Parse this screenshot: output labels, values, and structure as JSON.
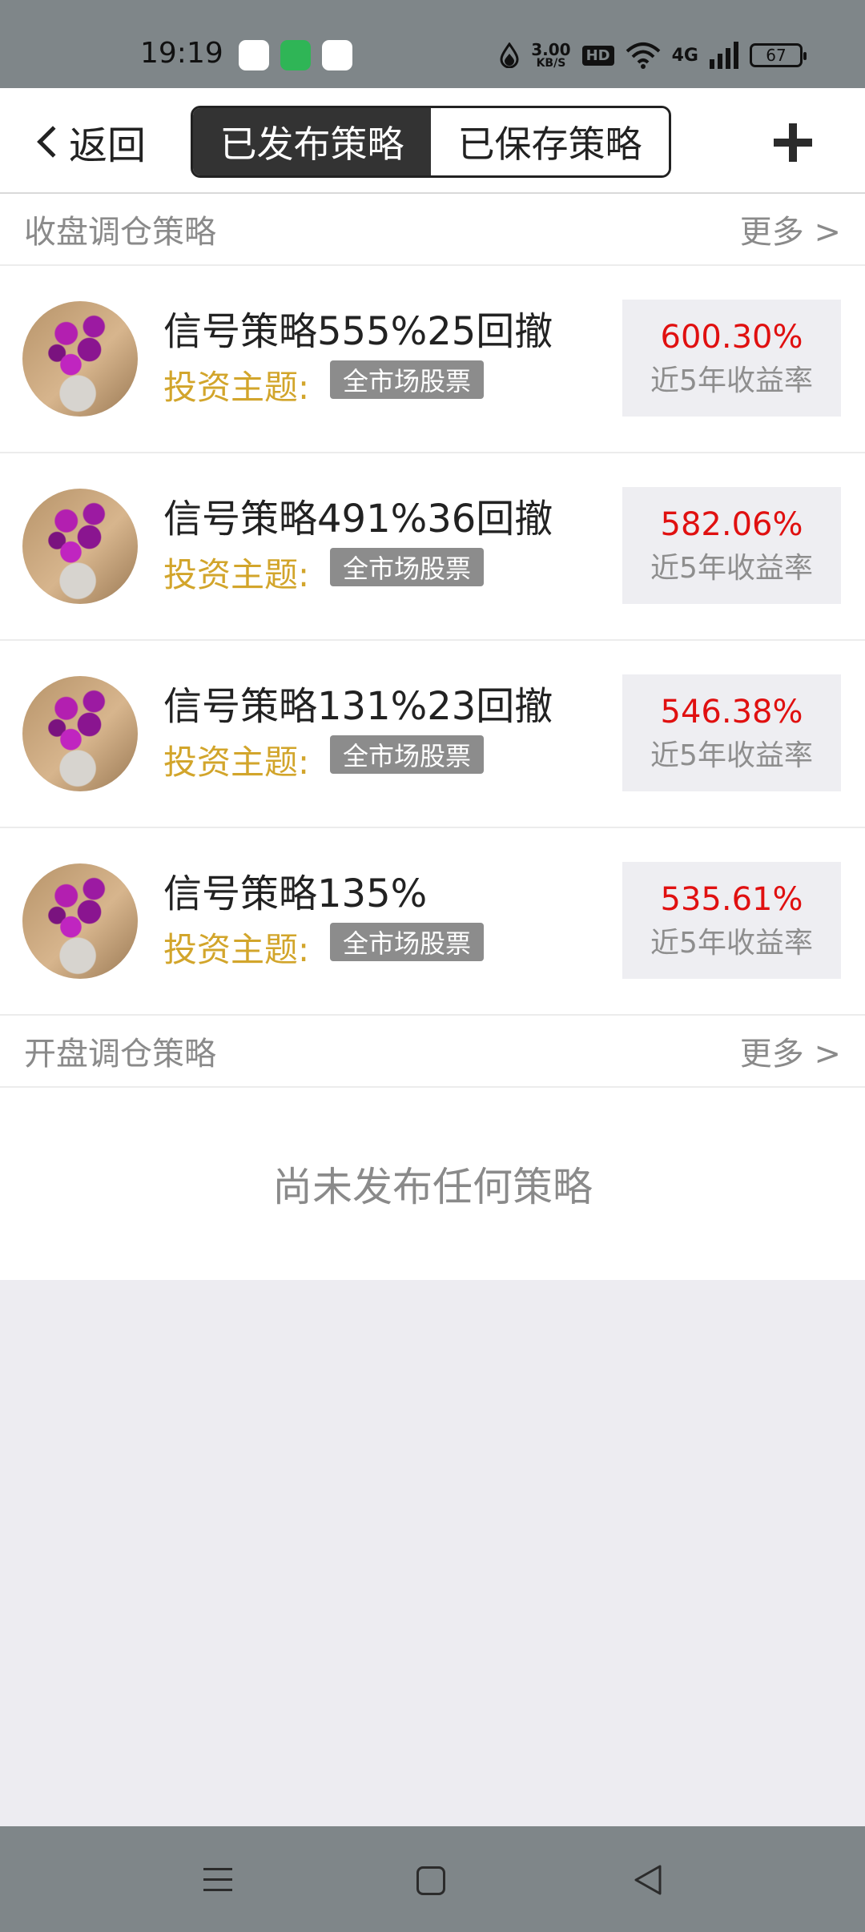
{
  "status_bar": {
    "time": "19:19",
    "net_speed_value": "3.00",
    "net_speed_unit": "KB/S",
    "hd_label": "HD",
    "network": "4G",
    "battery": "67"
  },
  "header": {
    "back_label": "返回",
    "tabs": [
      {
        "label": "已发布策略",
        "active": true
      },
      {
        "label": "已保存策略",
        "active": false
      }
    ],
    "add_icon": "plus-icon"
  },
  "sections": [
    {
      "title": "收盘调仓策略",
      "more_label": "更多 >",
      "items": [
        {
          "title": "信号策略555%25回撤",
          "topic_label": "投资主题:",
          "topic_tag": "全市场股票",
          "return_value": "600.30%",
          "return_label": "近5年收益率"
        },
        {
          "title": "信号策略491%36回撤",
          "topic_label": "投资主题:",
          "topic_tag": "全市场股票",
          "return_value": "582.06%",
          "return_label": "近5年收益率"
        },
        {
          "title": "信号策略131%23回撤",
          "topic_label": "投资主题:",
          "topic_tag": "全市场股票",
          "return_value": "546.38%",
          "return_label": "近5年收益率"
        },
        {
          "title": "信号策略135%",
          "topic_label": "投资主题:",
          "topic_tag": "全市场股票",
          "return_value": "535.61%",
          "return_label": "近5年收益率"
        }
      ]
    },
    {
      "title": "开盘调仓策略",
      "more_label": "更多 >",
      "empty_text": "尚未发布任何策略"
    }
  ],
  "colors": {
    "accent_dark": "#333333",
    "return_red": "#e01010",
    "topic_gold": "#d2a52b"
  }
}
